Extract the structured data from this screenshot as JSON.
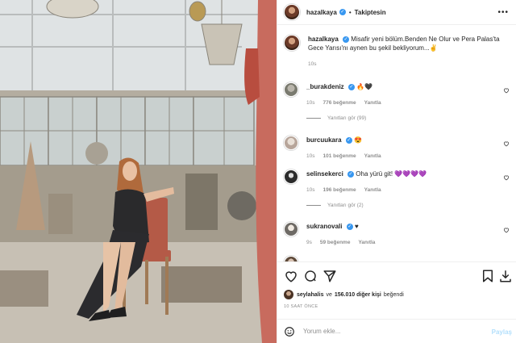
{
  "header": {
    "username": "hazalkaya",
    "separator": "•",
    "follow_label": "Takiptesin",
    "more_glyph": "•••"
  },
  "caption": {
    "username": "hazalkaya",
    "text": "Misafir yeni bölüm.Benden Ne Olur ve Pera Palas'ta Gece Yarısı'nı aynen bu şekil bekliyorum...✌",
    "time": "10s"
  },
  "comments": [
    {
      "username": "_burakdeniz",
      "verified": true,
      "text": "🔥🖤",
      "time": "10s",
      "likes": "776 beğenme",
      "reply_label": "Yanıtla",
      "view_replies": "Yanıtları gör (99)"
    },
    {
      "username": "burcuukara",
      "verified": true,
      "text": "😍",
      "time": "10s",
      "likes": "101 beğenme",
      "reply_label": "Yanıtla",
      "view_replies": ""
    },
    {
      "username": "selinsekerci",
      "verified": true,
      "text": "Oha yürü git! 💜💜💜💜",
      "time": "10s",
      "likes": "196 beğenme",
      "reply_label": "Yanıtla",
      "view_replies": "Yanıtları gör (2)"
    },
    {
      "username": "sukranovali",
      "verified": true,
      "text": "♥",
      "time": "9s",
      "likes": "59 beğenme",
      "reply_label": "Yanıtla",
      "view_replies": ""
    }
  ],
  "likes_summary": {
    "user": "seylahalis",
    "connector": "ve",
    "others": "156.010 diğer kişi",
    "suffix": "beğendi"
  },
  "post_time": "10 SAAT ÖNCE",
  "add_comment": {
    "placeholder": "Yorum ekle...",
    "post_label": "Paylaş"
  },
  "colors": {
    "verified": "#3897f0",
    "muted_text": "#8e8e8e",
    "post_button_disabled": "#b2dffc"
  },
  "icons": [
    "heart-icon",
    "comment-icon",
    "share-icon",
    "bookmark-icon",
    "save-icon",
    "emoji-icon",
    "more-icon",
    "verified-icon"
  ]
}
